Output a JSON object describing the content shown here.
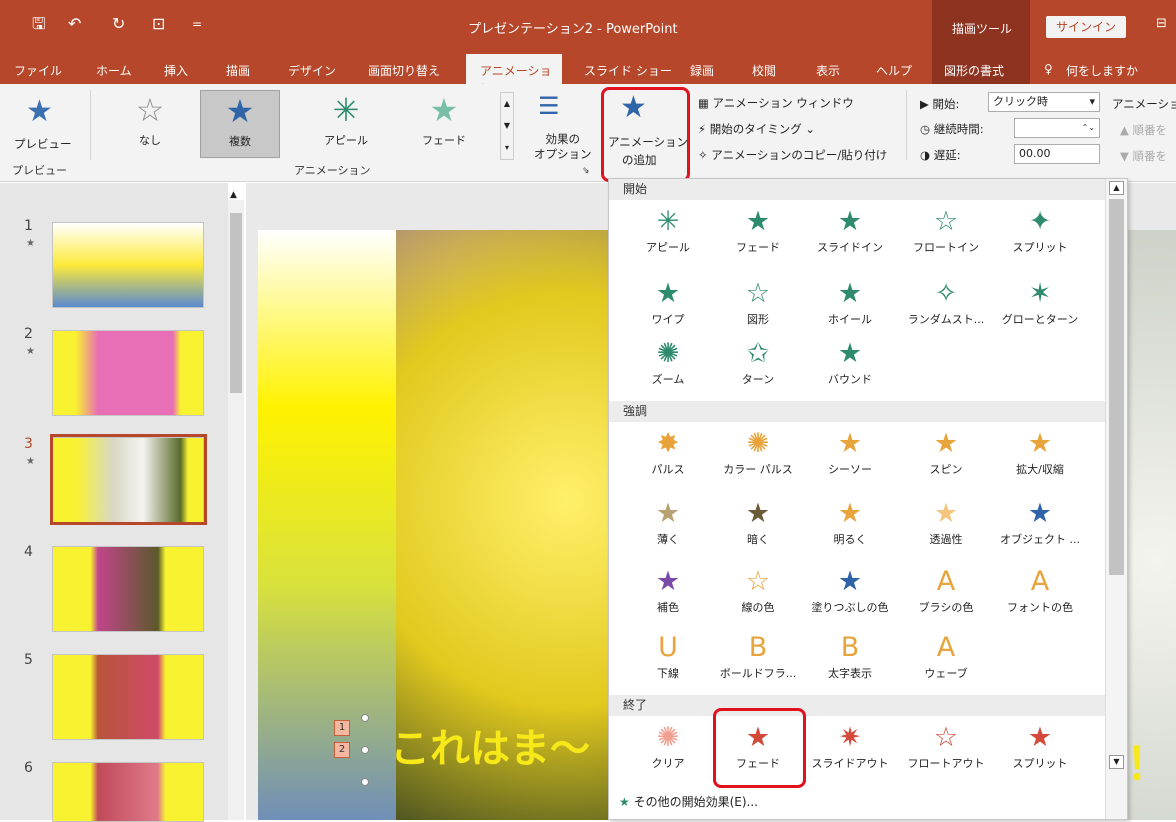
{
  "titlebar": {
    "title": "プレゼンテーション2 - PowerPoint",
    "context_label": "描画ツール",
    "signin": "サインイン",
    "save_icon": "save-icon",
    "undo": "↶",
    "redo": "↻",
    "present": "⊡",
    "qat_more": "="
  },
  "tabs": [
    "ファイル",
    "ホーム",
    "挿入",
    "描画",
    "デザイン",
    "画面切り替え",
    "アニメーション",
    "スライド ショー",
    "録画",
    "校閲",
    "表示",
    "ヘルプ",
    "図形の書式"
  ],
  "tell_me": "何をしますか",
  "ribbon": {
    "preview_label": "プレビュー",
    "gallery": [
      {
        "label": "なし",
        "icon": "☆"
      },
      {
        "label": "複数",
        "icon": "★"
      },
      {
        "label": "アピール",
        "icon": "✳"
      },
      {
        "label": "フェード",
        "icon": "★"
      }
    ],
    "effect_options": "効果の\nオプション",
    "add_animation_l1": "アニメーション",
    "add_animation_l2": "の追加",
    "anim_pane": "アニメーション ウィンドウ",
    "trigger": "開始のタイミング",
    "painter": "アニメーションのコピー/貼り付け",
    "start_label": "開始:",
    "start_value": "クリック時",
    "duration_label": "継続時間:",
    "delay_label": "遅延:",
    "delay_value": "00.00",
    "reorder": "アニメーショ",
    "order_up": "順番を",
    "order_down": "順番を",
    "group_preview": "プレビュー",
    "group_animation": "アニメーション"
  },
  "slides": [
    {
      "num": "1"
    },
    {
      "num": "2"
    },
    {
      "num": "3"
    },
    {
      "num": "4"
    },
    {
      "num": "5"
    },
    {
      "num": "6"
    }
  ],
  "slide": {
    "title": "これはま～",
    "tag1": "1",
    "tag2": "2",
    "trail": "！"
  },
  "dropdown": {
    "sections": [
      "開始",
      "強調",
      "終了"
    ],
    "entrance": [
      [
        "アピール",
        "✳"
      ],
      [
        "フェード",
        "★"
      ],
      [
        "スライドイン",
        "★"
      ],
      [
        "フロートイン",
        "☆"
      ],
      [
        "スプリット",
        "✦"
      ],
      [
        "ワイプ",
        "★"
      ],
      [
        "図形",
        "☆"
      ],
      [
        "ホイール",
        "★"
      ],
      [
        "ランダムスト...",
        "✧"
      ],
      [
        "グローとターン",
        "✶"
      ],
      [
        "ズーム",
        "✺"
      ],
      [
        "ターン",
        "✩"
      ],
      [
        "バウンド",
        "★"
      ]
    ],
    "emphasis": [
      [
        "パルス",
        "✸"
      ],
      [
        "カラー パルス",
        "✺"
      ],
      [
        "シーソー",
        "★"
      ],
      [
        "スピン",
        "★"
      ],
      [
        "拡大/収縮",
        "★"
      ],
      [
        "薄く",
        "★"
      ],
      [
        "暗く",
        "★"
      ],
      [
        "明るく",
        "★"
      ],
      [
        "透過性",
        "★"
      ],
      [
        "オブジェクト ...",
        "★"
      ],
      [
        "補色",
        "★"
      ],
      [
        "線の色",
        "☆"
      ],
      [
        "塗りつぶしの色",
        "★"
      ],
      [
        "ブラシの色",
        "A"
      ],
      [
        "フォントの色",
        "A"
      ],
      [
        "下線",
        "U"
      ],
      [
        "ボールドフラ...",
        "B"
      ],
      [
        "太字表示",
        "B"
      ],
      [
        "ウェーブ",
        "A"
      ]
    ],
    "exit": [
      [
        "クリア",
        "✺"
      ],
      [
        "フェード",
        "★"
      ],
      [
        "スライドアウト",
        "✷"
      ],
      [
        "フロートアウト",
        "☆"
      ],
      [
        "スプリット",
        "★"
      ]
    ],
    "more_entrance": "その他の開始効果(E)..."
  }
}
